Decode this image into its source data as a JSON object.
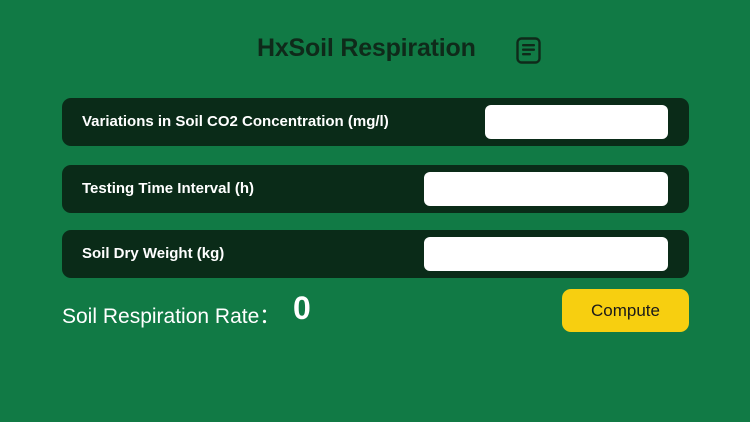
{
  "app": {
    "title": "HxSoil Respiration",
    "header_icon": "document-lines-icon"
  },
  "fields": [
    {
      "label": "Variations in Soil CO2 Concentration (mg/l)",
      "value": "",
      "placeholder": ""
    },
    {
      "label": "Testing Time Interval (h)",
      "value": "",
      "placeholder": ""
    },
    {
      "label": "Soil Dry Weight (kg)",
      "value": "",
      "placeholder": ""
    }
  ],
  "result": {
    "label": "Soil Respiration Rate：",
    "value": "0"
  },
  "actions": {
    "compute_label": "Compute"
  },
  "colors": {
    "background": "#117a45",
    "row_background": "#0a2b18",
    "button_background": "#f7cf10",
    "title_text": "#0f2a1a"
  }
}
